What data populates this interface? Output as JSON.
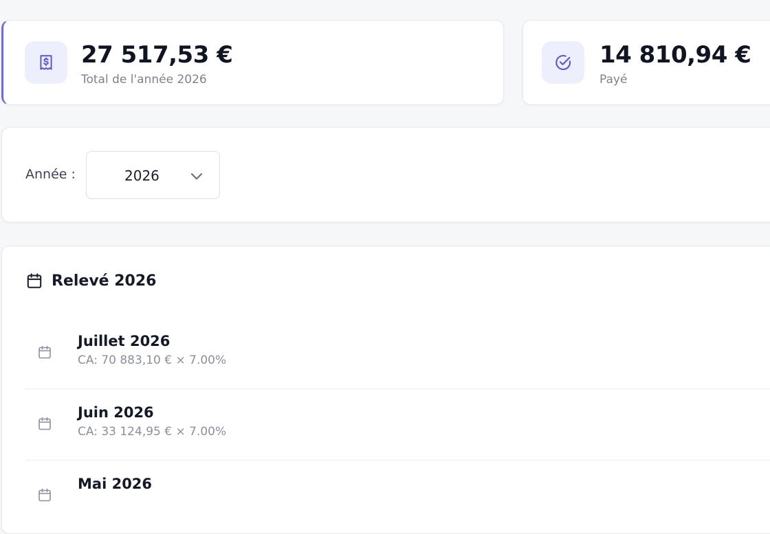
{
  "stats": {
    "total": {
      "value": "27 517,53 €",
      "label": "Total de l'année 2026",
      "icon": "receipt-dollar-icon",
      "accent": "#6f6bdc"
    },
    "paid": {
      "value": "14 810,94 €",
      "label": "Payé",
      "icon": "check-circle-icon"
    }
  },
  "filter": {
    "label": "Année :",
    "year": "2026"
  },
  "statement": {
    "title": "Relevé 2026",
    "months": [
      {
        "name": "Juillet 2026",
        "detail": "CA: 70 883,10 € × 7.00%"
      },
      {
        "name": "Juin 2026",
        "detail": "CA: 33 124,95 € × 7.00%"
      },
      {
        "name": "Mai 2026",
        "detail": ""
      }
    ]
  }
}
